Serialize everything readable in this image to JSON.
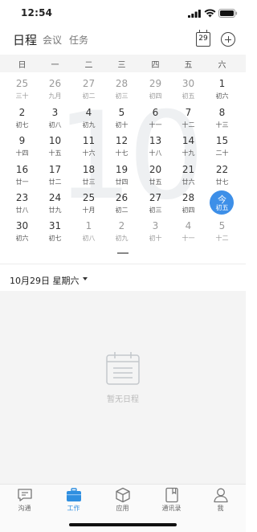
{
  "status_bar": {
    "time": "12:54"
  },
  "header": {
    "tabs": [
      {
        "label": "日程",
        "active": true
      },
      {
        "label": "会议",
        "active": false
      },
      {
        "label": "任务",
        "active": false
      }
    ],
    "calendar_icon_day": "29",
    "icons": [
      "calendar-today-icon",
      "add-icon"
    ]
  },
  "calendar": {
    "weekdays": [
      "日",
      "一",
      "二",
      "三",
      "四",
      "五",
      "六"
    ],
    "watermark_month": "10",
    "weeks": [
      [
        {
          "n": "25",
          "l": "三十",
          "other": true
        },
        {
          "n": "26",
          "l": "九月",
          "other": true
        },
        {
          "n": "27",
          "l": "初二",
          "other": true
        },
        {
          "n": "28",
          "l": "初三",
          "other": true
        },
        {
          "n": "29",
          "l": "初四",
          "other": true
        },
        {
          "n": "30",
          "l": "初五",
          "other": true
        },
        {
          "n": "1",
          "l": "初六",
          "other": false
        }
      ],
      [
        {
          "n": "2",
          "l": "初七",
          "other": false
        },
        {
          "n": "3",
          "l": "初八",
          "other": false
        },
        {
          "n": "4",
          "l": "初九",
          "other": false
        },
        {
          "n": "5",
          "l": "初十",
          "other": false
        },
        {
          "n": "6",
          "l": "十一",
          "other": false
        },
        {
          "n": "7",
          "l": "十二",
          "other": false
        },
        {
          "n": "8",
          "l": "十三",
          "other": false
        }
      ],
      [
        {
          "n": "9",
          "l": "十四",
          "other": false
        },
        {
          "n": "10",
          "l": "十五",
          "other": false
        },
        {
          "n": "11",
          "l": "十六",
          "other": false
        },
        {
          "n": "12",
          "l": "十七",
          "other": false
        },
        {
          "n": "13",
          "l": "十八",
          "other": false
        },
        {
          "n": "14",
          "l": "十九",
          "other": false
        },
        {
          "n": "15",
          "l": "二十",
          "other": false
        }
      ],
      [
        {
          "n": "16",
          "l": "廿一",
          "other": false
        },
        {
          "n": "17",
          "l": "廿二",
          "other": false
        },
        {
          "n": "18",
          "l": "廿三",
          "other": false
        },
        {
          "n": "19",
          "l": "廿四",
          "other": false
        },
        {
          "n": "20",
          "l": "廿五",
          "other": false
        },
        {
          "n": "21",
          "l": "廿六",
          "other": false
        },
        {
          "n": "22",
          "l": "廿七",
          "other": false
        }
      ],
      [
        {
          "n": "23",
          "l": "廿八",
          "other": false
        },
        {
          "n": "24",
          "l": "廿九",
          "other": false
        },
        {
          "n": "25",
          "l": "十月",
          "other": false
        },
        {
          "n": "26",
          "l": "初二",
          "other": false
        },
        {
          "n": "27",
          "l": "初三",
          "other": false
        },
        {
          "n": "28",
          "l": "初四",
          "other": false
        },
        {
          "n": "今",
          "l": "初五",
          "other": false,
          "today": true
        }
      ],
      [
        {
          "n": "30",
          "l": "初六",
          "other": false
        },
        {
          "n": "31",
          "l": "初七",
          "other": false
        },
        {
          "n": "1",
          "l": "初八",
          "other": true
        },
        {
          "n": "2",
          "l": "初九",
          "other": true
        },
        {
          "n": "3",
          "l": "初十",
          "other": true
        },
        {
          "n": "4",
          "l": "十一",
          "other": true
        },
        {
          "n": "5",
          "l": "十二",
          "other": true
        }
      ]
    ]
  },
  "selected_date": "10月29日 星期六",
  "empty_state": {
    "text": "暂无日程",
    "icon": "empty-calendar-icon"
  },
  "tabbar": {
    "items": [
      {
        "label": "沟通",
        "icon": "chat-icon",
        "active": false
      },
      {
        "label": "工作",
        "icon": "briefcase-icon",
        "active": true
      },
      {
        "label": "应用",
        "icon": "cube-icon",
        "active": false
      },
      {
        "label": "通讯录",
        "icon": "contacts-book-icon",
        "active": false
      },
      {
        "label": "我",
        "icon": "person-icon",
        "active": false
      }
    ]
  },
  "colors": {
    "accent": "#3d8fe8",
    "tab_active": "#2f8fe0",
    "muted": "#9a9a9a"
  }
}
